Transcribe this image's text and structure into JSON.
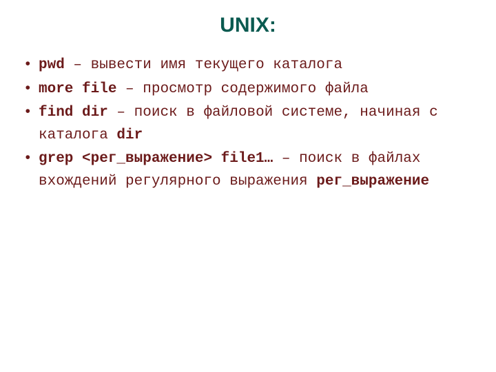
{
  "title": "UNIX:",
  "items": {
    "i0": {
      "cmd": "pwd",
      "sep": " – ",
      "desc": "вывести имя текущего каталога"
    },
    "i1": {
      "cmd": "more file",
      "sep": " – ",
      "desc": "просмотр содержимого файла"
    },
    "i2": {
      "cmd": "find dir",
      "sep": " – ",
      "desc1": "поиск в файловой системе, начиная с каталога ",
      "arg": "dir"
    },
    "i3": {
      "cmd": "grep <рег_выражение> file1…",
      "sep": " – ",
      "desc1": "поиск в файлах вхождений регулярного выражения ",
      "arg": "рег_выражение"
    }
  }
}
